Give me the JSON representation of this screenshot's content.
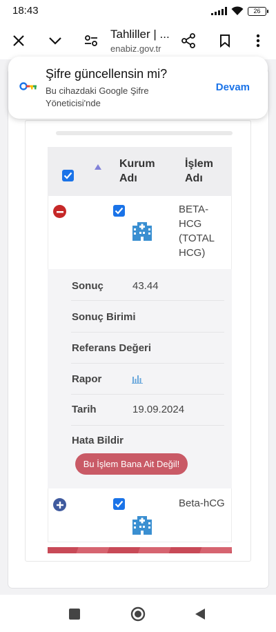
{
  "status_bar": {
    "time": "18:43",
    "battery": "26",
    "icons": [
      "signal-icon",
      "wifi-icon",
      "battery-icon"
    ]
  },
  "browser": {
    "title": "Tahliller | ...",
    "url": "enabiz.gov.tr",
    "buttons": [
      "close-icon",
      "chevron-down-icon",
      "site-settings-icon",
      "share-icon",
      "bookmark-icon",
      "more-icon"
    ]
  },
  "password_prompt": {
    "title": "Şifre güncellensin mi?",
    "subtitle": "Bu cihazdaki Google Şifre Yöneticisi'nde",
    "action": "Devam"
  },
  "table": {
    "header": {
      "col_institution": "Kurum Adı",
      "col_procedure": "İşlem Adı"
    },
    "rows": [
      {
        "procedure": "BETA-HCG (TOTAL HCG)",
        "expanded": true,
        "checked": true
      },
      {
        "procedure": "Beta-hCG",
        "expanded": false,
        "checked": true
      }
    ],
    "details": {
      "result_label": "Sonuç",
      "result_value": "43.44",
      "unit_label": "Sonuç Birimi",
      "unit_value": "",
      "reference_label": "Referans Değeri",
      "reference_value": "",
      "report_label": "Rapor",
      "date_label": "Tarih",
      "date_value": "19.09.2024",
      "error_label": "Hata Bildir",
      "error_button": "Bu İşlem Bana Ait Değil!"
    }
  },
  "colors": {
    "accent": "#1a73e8",
    "danger": "#c62828",
    "plus": "#3f5a9e",
    "report_button": "#c95a66",
    "hospital_icon": "#3a8fd1"
  }
}
